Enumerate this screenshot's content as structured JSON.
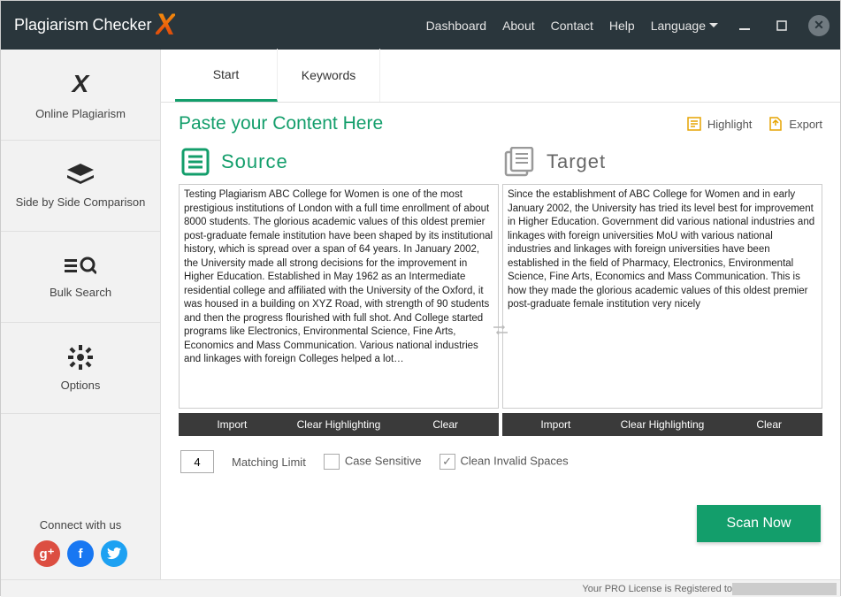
{
  "logo": {
    "line1": "Plagiarism",
    "line2": "Checker",
    "x": "X"
  },
  "topmenu": {
    "dashboard": "Dashboard",
    "about": "About",
    "contact": "Contact",
    "help": "Help",
    "language": "Language"
  },
  "sidebar": {
    "items": [
      {
        "label": "Online Plagiarism"
      },
      {
        "label": "Side by Side Comparison"
      },
      {
        "label": "Bulk Search"
      },
      {
        "label": "Options"
      }
    ],
    "connect": "Connect with us"
  },
  "tabs": {
    "start": "Start",
    "keywords": "Keywords"
  },
  "header": {
    "title": "Paste your Content Here",
    "highlight": "Highlight",
    "export": "Export"
  },
  "panels": {
    "source_label": "Source",
    "target_label": "Target",
    "source_text": "Testing Plagiarism ABC College for Women is one of the most prestigious institutions of London with a full time enrollment of about 8000 students. The glorious academic values of this oldest premier post-graduate female institution have been shaped by its institutional history, which is spread over a span of 64 years. In January 2002, the University made all strong decisions for the improvement in Higher Education. Established in May 1962 as an Intermediate residential college and affiliated with the University of the Oxford, it was housed in a building on XYZ Road, with strength of 90 students and then the progress flourished with full shot. And College started programs like Electronics, Environmental Science, Fine Arts, Economics and Mass Communication. Various national industries and linkages with foreign Colleges helped a lot…",
    "target_text": "Since the establishment of ABC College for Women and in early January 2002, the University has tried its level best for improvement in Higher Education. Government did various national industries and linkages with foreign universities MoU with various national industries and linkages with foreign universities have been established in the field of Pharmacy, Electronics, Environmental Science, Fine Arts, Economics and Mass Communication. This is how they made the glorious academic values of this oldest premier post-graduate female institution very nicely",
    "import": "Import",
    "clear_highlighting": "Clear Highlighting",
    "clear": "Clear"
  },
  "options": {
    "matching_limit_value": "4",
    "matching_limit_label": "Matching Limit",
    "case_sensitive": "Case Sensitive",
    "clean_invalid": "Clean Invalid Spaces"
  },
  "scan_button": "Scan Now",
  "status": "Your PRO License is Registered to"
}
